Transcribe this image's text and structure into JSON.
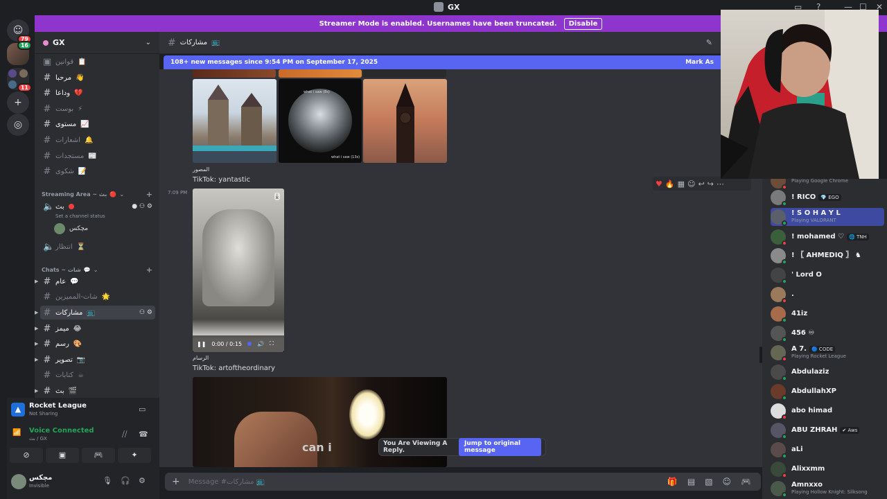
{
  "window": {
    "title": "GX"
  },
  "guilds": {
    "dm_badge": "79",
    "server_badge_1": "16",
    "server_badge_2": "11"
  },
  "banner": {
    "text": "Streamer Mode is enabled. Usernames have been truncated.",
    "button": "Disable"
  },
  "server": {
    "name": "GX"
  },
  "channels": [
    {
      "name": "قوانين",
      "emoji": "📋",
      "icon": "rules-icon"
    },
    {
      "name": "مرحبا",
      "emoji": "👋"
    },
    {
      "name": "وداعا",
      "emoji": "💔"
    },
    {
      "name": "بوست",
      "emoji": "⚡"
    },
    {
      "name": "مستوى",
      "emoji": "📈"
    },
    {
      "name": "اشعارات",
      "emoji": "🔔"
    },
    {
      "name": "مستجدات",
      "emoji": "📰"
    },
    {
      "name": "شكوى",
      "emoji": "📝"
    }
  ],
  "streaming_category": {
    "name": "Streaming Area ~ بث",
    "emoji": "🔴"
  },
  "voice_channel": {
    "name": "بث",
    "status": "Set a channel status",
    "user": "مچكس"
  },
  "voice_channel_2": {
    "name": "انتظار",
    "emoji": "⏳"
  },
  "chats_category": {
    "name": "Chats ~ شات",
    "emoji": "💬"
  },
  "chat_channels": [
    {
      "name": "عام",
      "emoji": "💬"
    },
    {
      "name": "شات-المميزين",
      "emoji": "🌟"
    },
    {
      "name": "مشاركات",
      "emoji": "📺"
    },
    {
      "name": "ميمز",
      "emoji": "😂"
    },
    {
      "name": "رسم",
      "emoji": "🎨"
    },
    {
      "name": "تصوير",
      "emoji": "📷"
    },
    {
      "name": "كتابات",
      "emoji": "☕"
    },
    {
      "name": "بث",
      "emoji": "🎬"
    }
  ],
  "activity": {
    "game": "Rocket League",
    "status": "Not Sharing"
  },
  "voice": {
    "status": "Voice Connected",
    "channel": "بث / GX"
  },
  "user": {
    "name": "مچكس",
    "status": "Invisible"
  },
  "header": {
    "channel": "مشاركات",
    "emoji": "📺"
  },
  "newbar": {
    "text": "108+ new messages since 9:54 PM on September 17, 2025",
    "mark": "Mark As"
  },
  "messages": [
    {
      "label": "المصور",
      "text": "TikTok: yantastic"
    },
    {
      "time": "7:09 PM",
      "video_time": "0:00 / 0:15",
      "label": "الرسام",
      "text": "TikTok: artoftheordinary"
    }
  ],
  "thumb_captions": {
    "cap1": "what i saw (8s)",
    "cap2": "what i saw (13s)"
  },
  "video_caption": "can i",
  "reply": {
    "text": "You Are Viewing A Reply.",
    "button": "Jump to original message"
  },
  "composer": {
    "placeholder": "Message #مشاركات",
    "emoji": "📺"
  },
  "members": [
    {
      "name": "",
      "activity": "Playing Google Chrome",
      "color": "#6b4d3a"
    },
    {
      "name": "! RICO",
      "tag": "💎 EGO",
      "activity": "",
      "color": "#7a7a7a"
    },
    {
      "name": "! S O H A Y L",
      "activity": "Playing VALORANT",
      "color": "#5a5f6a"
    },
    {
      "name": "! mohamed ♡",
      "tag": "🌐 TNH",
      "activity": "",
      "color": "#3a5f3a"
    },
    {
      "name": "! 〖 AHMEDIQ 〗 ♞",
      "activity": "",
      "color": "#8a8a8a"
    },
    {
      "name": "' Lord O",
      "activity": "",
      "color": "#444"
    },
    {
      "name": ".",
      "activity": "",
      "color": "#9a7a5a"
    },
    {
      "name": "41iz",
      "activity": "",
      "color": "#a56b4a"
    },
    {
      "name": "456 ♾",
      "activity": "",
      "color": "#555"
    },
    {
      "name": "A 7.",
      "tag": "🔵 CODE",
      "activity": "Playing Rocket League",
      "color": "#665"
    },
    {
      "name": "Abdulaziz",
      "activity": "",
      "color": "#4a4a4a"
    },
    {
      "name": "AbdullahXP",
      "activity": "",
      "color": "#6a3a2a"
    },
    {
      "name": "abo himad",
      "activity": "",
      "color": "#ddd"
    },
    {
      "name": "ABU ZHRAH",
      "tag": "✔ Aws",
      "activity": "",
      "color": "#556"
    },
    {
      "name": "aLi",
      "activity": "",
      "color": "#5a4a4a"
    },
    {
      "name": "Alixxmm",
      "activity": "",
      "color": "#3a4a3a"
    },
    {
      "name": "Amnxxo",
      "activity": "Playing Hollow Knight: Silksong",
      "color": "#4a5a4a"
    }
  ]
}
